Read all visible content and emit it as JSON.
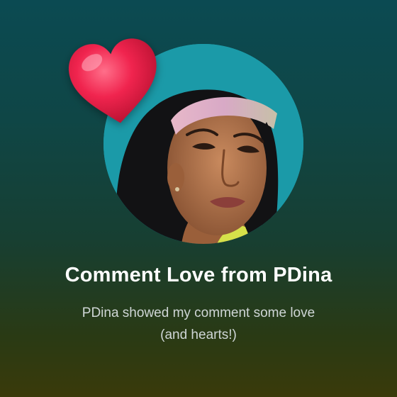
{
  "card": {
    "title": "Comment Love from PDina",
    "subtitle_line1": "PDina showed my comment some love",
    "subtitle_line2": "(and hearts!)"
  },
  "icons": {
    "heart": "heart-icon",
    "avatar": "user-avatar-photo"
  },
  "colors": {
    "heart": "#f0244e",
    "avatar_background": "#1b9aa8",
    "title_text": "#ffffff",
    "subtitle_text": "#cfd6d6"
  }
}
